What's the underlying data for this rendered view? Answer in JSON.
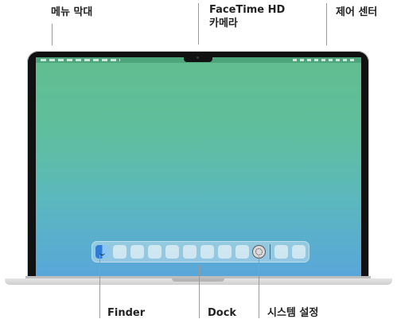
{
  "labels": {
    "menubar": "메뉴 막대",
    "camera_line1": "FaceTime HD",
    "camera_line2": "카메라",
    "control_center": "제어 센터",
    "finder": "Finder",
    "dock": "Dock",
    "system_settings": "시스템 설정"
  },
  "dock": {
    "icons": [
      "finder-icon",
      "app-icon",
      "app-icon",
      "app-icon",
      "app-icon",
      "app-icon",
      "app-icon",
      "app-icon",
      "app-icon",
      "app-icon",
      "system-settings-icon",
      "app-icon",
      "app-icon"
    ]
  },
  "colors": {
    "wallpaper_top": "#62be8f",
    "wallpaper_bottom": "#59a6da",
    "bezel": "#111111",
    "label_text": "#222222"
  }
}
